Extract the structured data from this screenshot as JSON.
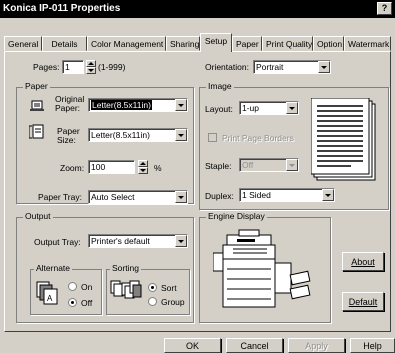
{
  "window": {
    "title": "Konica IP-011 Properties",
    "help_label": "?"
  },
  "tabs": [
    "General",
    "Details",
    "Color Management",
    "Sharing",
    "Setup",
    "Paper",
    "Print Quality",
    "Option",
    "Watermark"
  ],
  "active_tab": "Setup",
  "pages": {
    "label": "Pages:",
    "value": "1",
    "range": "(1-999)"
  },
  "paper": {
    "group": "Paper",
    "original_label_1": "Original",
    "original_label_2": "Paper:",
    "original_value": "Letter(8.5x11in)",
    "size_label_1": "Paper",
    "size_label_2": "Size:",
    "size_value": "Letter(8.5x11in)",
    "zoom_label": "Zoom:",
    "zoom_value": "100",
    "zoom_unit": "%",
    "tray_label": "Paper Tray:",
    "tray_value": "Auto Select"
  },
  "orientation": {
    "label": "Orientation:",
    "value": "Portrait"
  },
  "image": {
    "group": "Image",
    "layout_label": "Layout:",
    "layout_value": "1-up",
    "print_borders_label": "Print Page Borders",
    "staple_label": "Staple:",
    "staple_value": "Off",
    "duplex_label": "Duplex:",
    "duplex_value": "1 Sided"
  },
  "output": {
    "group": "Output",
    "tray_label": "Output Tray:",
    "tray_value": "Printer's default",
    "alternate_group": "Alternate",
    "alternate_on": "On",
    "alternate_off": "Off",
    "sorting_group": "Sorting",
    "sort_label": "Sort",
    "group_label": "Group"
  },
  "engine": {
    "group": "Engine Display"
  },
  "side_buttons": {
    "about": "About",
    "default": "Default"
  },
  "footer": {
    "ok": "OK",
    "cancel": "Cancel",
    "apply": "Apply",
    "help": "Help"
  }
}
